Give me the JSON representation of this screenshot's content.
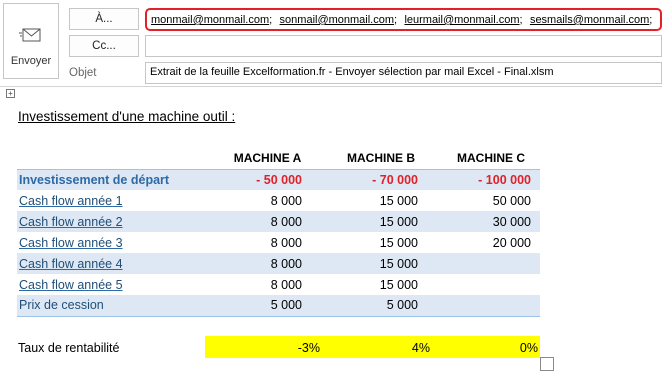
{
  "compose": {
    "send_label": "Envoyer",
    "to_label": "À...",
    "cc_label": "Cc...",
    "subject_label": "Objet",
    "recipients": [
      "monmail@monmail.com",
      "sonmail@monmail.com",
      "leurmail@monmail.com",
      "sesmails@monmail.com"
    ],
    "separator": ";",
    "cc_value": "",
    "subject": "Extrait de la feuille Excelformation.fr - Envoyer sélection par mail Excel - Final.xlsm"
  },
  "body": {
    "title": "Investissement d'une machine outil :",
    "table": {
      "headers": [
        "",
        "MACHINE A",
        "MACHINE B",
        "MACHINE C"
      ],
      "rows": [
        {
          "label": "Investissement de départ",
          "values": [
            "- 50 000",
            "- 70 000",
            "- 100 000"
          ]
        },
        {
          "label": "Cash flow année 1",
          "values": [
            "8 000",
            "15 000",
            "50 000"
          ]
        },
        {
          "label": "Cash flow année 2",
          "values": [
            "8 000",
            "15 000",
            "30 000"
          ]
        },
        {
          "label": "Cash flow année 3",
          "values": [
            "8 000",
            "15 000",
            "20 000"
          ]
        },
        {
          "label": "Cash flow année 4",
          "values": [
            "8 000",
            "15 000",
            ""
          ]
        },
        {
          "label": "Cash flow année 5",
          "values": [
            "8 000",
            "15 000",
            ""
          ]
        },
        {
          "label": "Prix de cession",
          "values": [
            "5 000",
            "5 000",
            ""
          ]
        }
      ]
    },
    "rate": {
      "label": "Taux de rentabilité",
      "values": [
        "-3%",
        "4%",
        "0%"
      ]
    }
  },
  "colors": {
    "highlight_border": "#e0212a",
    "negative": "#e0212a",
    "header_blue": "#2e6aa6",
    "band": "#dde8f4",
    "rate_fill": "#ffff00"
  }
}
